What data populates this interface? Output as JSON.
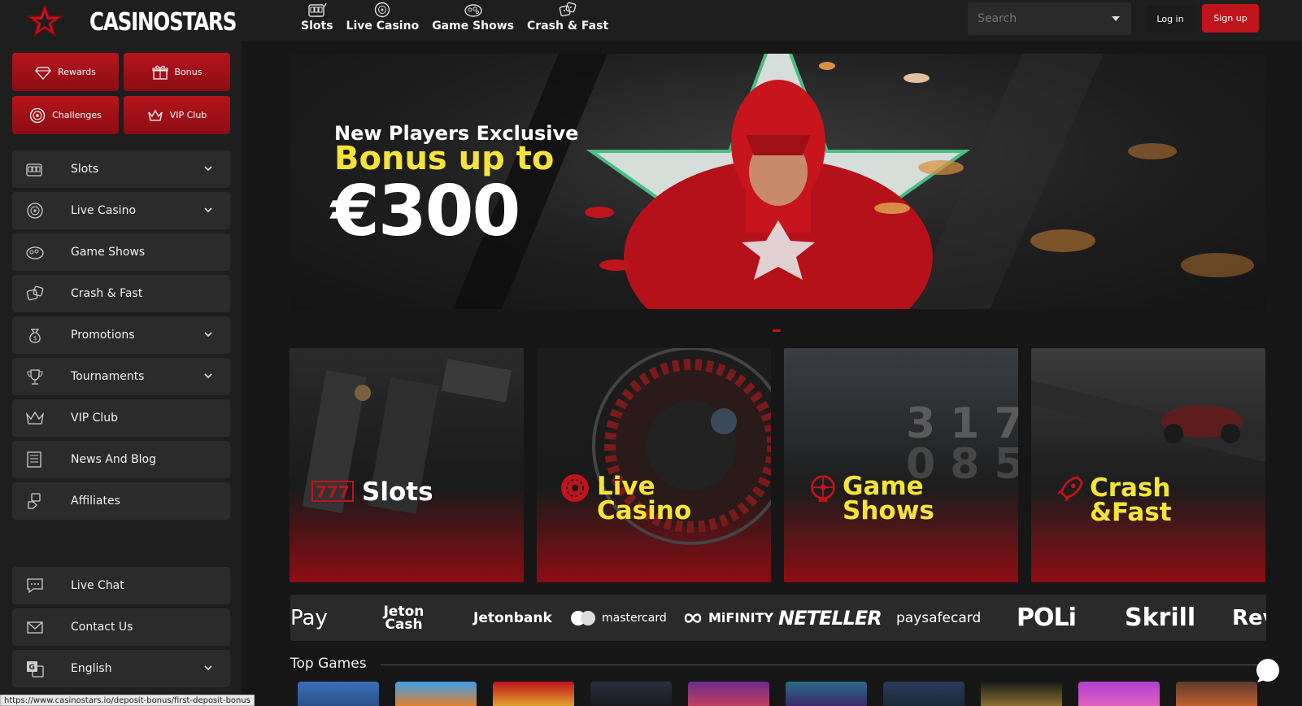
{
  "brand": {
    "name": "CASINOSTARS",
    "accent": "#c0141c",
    "highlight": "#f5e33a"
  },
  "topnav": [
    {
      "label": "Slots",
      "icon": "slot-machine-icon"
    },
    {
      "label": "Live Casino",
      "icon": "roulette-icon"
    },
    {
      "label": "Game Shows",
      "icon": "game-show-icon"
    },
    {
      "label": "Crash & Fast",
      "icon": "dice-icon"
    }
  ],
  "search": {
    "placeholder": "Search"
  },
  "auth": {
    "login": "Log in",
    "signup": "Sign up"
  },
  "quick_actions": [
    {
      "label": "Rewards",
      "icon": "diamond-icon"
    },
    {
      "label": "Bonus",
      "icon": "gift-icon"
    },
    {
      "label": "Challenges",
      "icon": "target-icon"
    },
    {
      "label": "VIP Club",
      "icon": "crown-icon"
    }
  ],
  "sidebar_menu": [
    {
      "label": "Slots",
      "icon": "slot-machine-icon",
      "expandable": true
    },
    {
      "label": "Live Casino",
      "icon": "roulette-icon",
      "expandable": true
    },
    {
      "label": "Game Shows",
      "icon": "game-show-icon",
      "expandable": false
    },
    {
      "label": "Crash & Fast",
      "icon": "dice-icon",
      "expandable": false
    },
    {
      "label": "Promotions",
      "icon": "money-bag-icon",
      "expandable": true
    },
    {
      "label": "Tournaments",
      "icon": "trophy-icon",
      "expandable": true
    },
    {
      "label": "VIP Club",
      "icon": "crown-icon",
      "expandable": false
    },
    {
      "label": "News And Blog",
      "icon": "newspaper-icon",
      "expandable": false
    },
    {
      "label": "Affiliates",
      "icon": "handshake-icon",
      "expandable": false
    }
  ],
  "sidebar_bottom": [
    {
      "label": "Live Chat",
      "icon": "chat-icon",
      "expandable": false
    },
    {
      "label": "Contact Us",
      "icon": "mail-icon",
      "expandable": false
    },
    {
      "label": "English",
      "icon": "translate-icon",
      "expandable": true
    }
  ],
  "hero": {
    "line1": "New Players Exclusive",
    "line2": "Bonus up to",
    "line3": "€300"
  },
  "categories": [
    {
      "title": "Slots",
      "icon": "777-icon"
    },
    {
      "title_line1": "Live",
      "title_line2": "Casino",
      "icon": "roulette-icon"
    },
    {
      "title_line1": "Game",
      "title_line2": "Shows",
      "icon": "wheel-icon"
    },
    {
      "title_line1": "Crash",
      "title_line2": "&Fast",
      "icon": "rocket-icon"
    }
  ],
  "payments": [
    "Pay",
    "Jeton Cash",
    "Jetonbank",
    "mastercard",
    "MiFINITY",
    "NETELLER",
    "paysafecard",
    "POLi",
    "Skrill",
    "Rev"
  ],
  "top_games": {
    "title": "Top Games"
  },
  "status_url": "https://www.casinostars.io/deposit-bonus/first-deposit-bonus"
}
